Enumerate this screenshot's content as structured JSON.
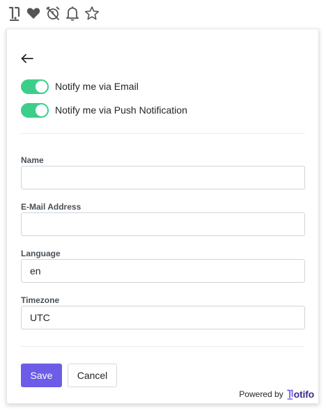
{
  "topbar": {
    "icons": [
      "notifo-logo-icon",
      "heart-icon",
      "alarm-off-icon",
      "bell-icon",
      "star-icon"
    ]
  },
  "panel": {
    "back_icon": "arrow-left-icon",
    "toggles": [
      {
        "label": "Notify me via Email",
        "on": true
      },
      {
        "label": "Notify me via Push Notification",
        "on": true
      }
    ],
    "fields": [
      {
        "label": "Name",
        "value": ""
      },
      {
        "label": "E-Mail Address",
        "value": ""
      },
      {
        "label": "Language",
        "value": "en"
      },
      {
        "label": "Timezone",
        "value": "UTC"
      }
    ],
    "buttons": {
      "save": "Save",
      "cancel": "Cancel"
    },
    "footer": {
      "powered_by": "Powered by",
      "brand": "otifo"
    }
  },
  "colors": {
    "toggle_on": "#3ccf8a",
    "primary": "#6c5ce7",
    "brand": "#3d2b8f"
  }
}
